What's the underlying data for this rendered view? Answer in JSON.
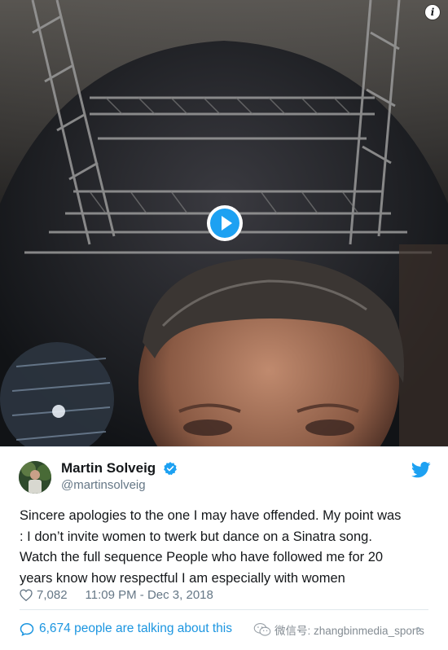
{
  "media": {
    "info_glyph": "i",
    "play_icon": "play-icon"
  },
  "tweet": {
    "author_name": "Martin Solveig",
    "author_handle": "@martinsolveig",
    "verified": true,
    "text_lines": [
      "Sincere apologies to the one I may have offended. My point was",
      ": I don’t invite women to twerk but dance on a Sinatra song.",
      "Watch the full sequence People who have followed me for 20",
      "years know how respectful I am especially with women"
    ],
    "likes": "7,082",
    "timestamp": "11:09 PM - Dec 3, 2018",
    "talking_count": "6,674 people are talking about this",
    "chevron": "›"
  },
  "watermark": {
    "text": "微信号: zhangbinmedia_sports"
  },
  "colors": {
    "twitter_blue": "#1da1f2",
    "link_blue": "#1b95e0",
    "muted": "#657786"
  }
}
